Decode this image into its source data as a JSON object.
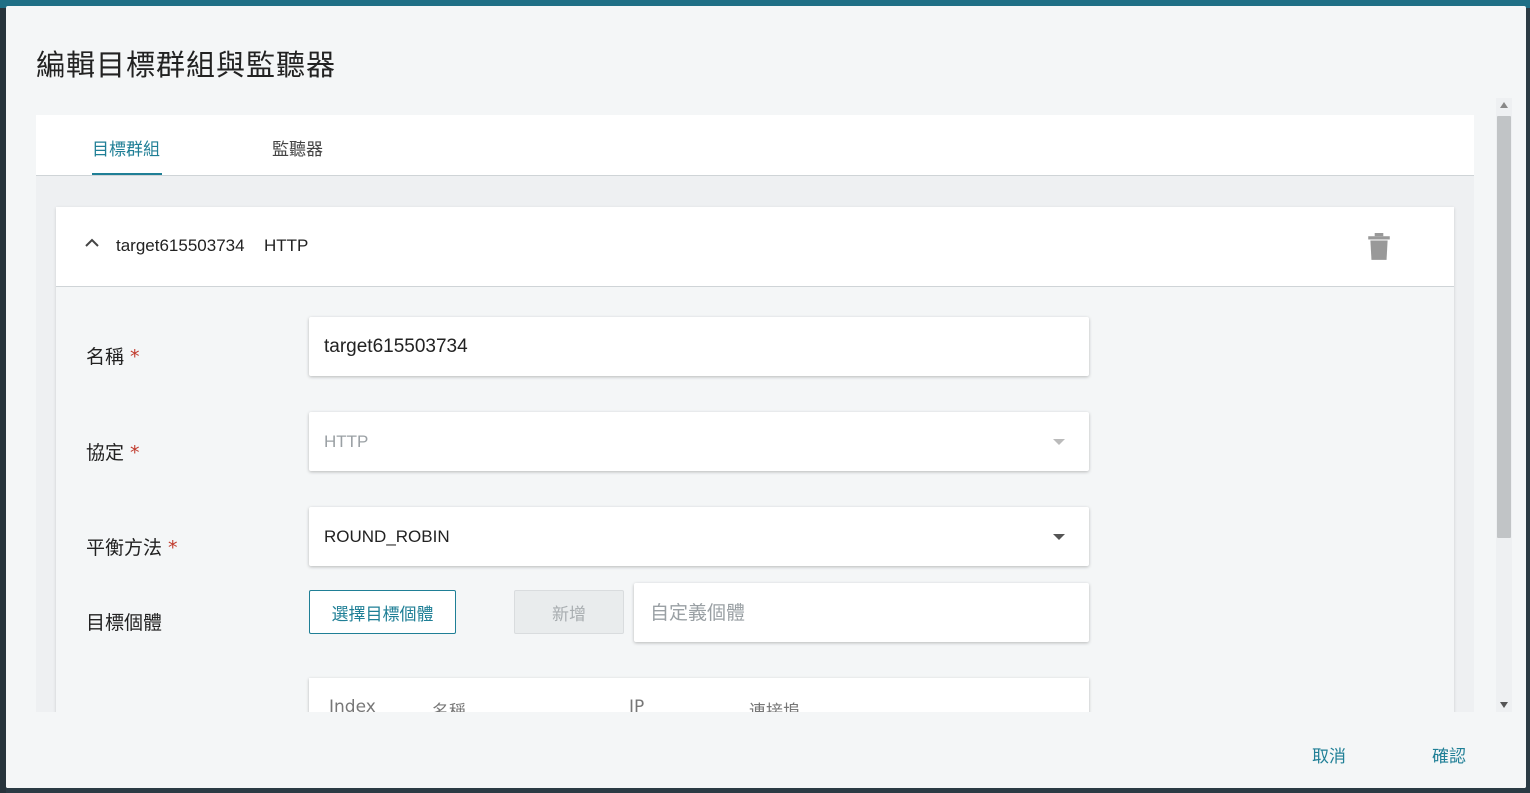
{
  "dialog": {
    "title": "編輯目標群組與監聽器"
  },
  "tabs": [
    {
      "label": "目標群組",
      "active": true
    },
    {
      "label": "監聽器",
      "active": false
    }
  ],
  "target_group": {
    "header_name": "target615503734",
    "header_protocol": "HTTP",
    "name_label": "名稱",
    "name_value": "target615503734",
    "protocol_label": "協定",
    "protocol_value": "HTTP",
    "balance_label": "平衡方法",
    "balance_value": "ROUND_ROBIN",
    "targets_label": "目標個體",
    "required_mark": "*",
    "select_targets_button": "選擇目標個體",
    "add_button": "新增",
    "custom_placeholder": "自定義個體",
    "table_headers": [
      "Index",
      "名稱",
      "IP",
      "連接埠"
    ]
  },
  "footer": {
    "cancel": "取消",
    "confirm": "確認"
  },
  "colors": {
    "accent": "#1f7f96",
    "required": "#c0392b"
  }
}
